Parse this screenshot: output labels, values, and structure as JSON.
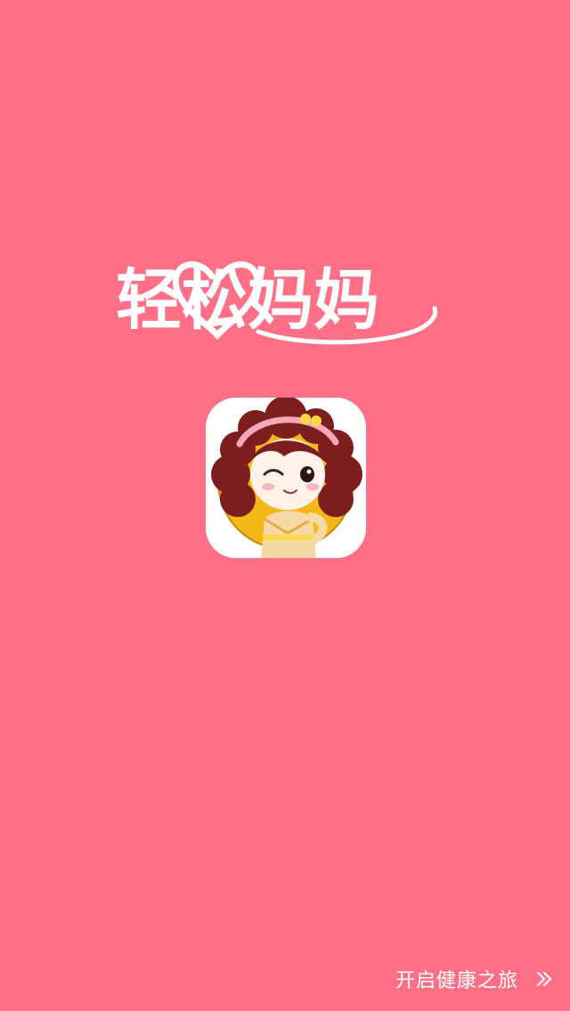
{
  "splash": {
    "logo_text": "轻松妈妈",
    "start_label": "开启健康之旅",
    "icons": {
      "app_icon": "cartoon-girl-app-icon",
      "forward": "double-chevron-right-icon"
    }
  },
  "colors": {
    "background": "#FF7087",
    "text": "#FFFFFF",
    "icon_background": "#FFFFFF",
    "icon_circle": "#F5B819",
    "hair": "#7D1E1E"
  }
}
